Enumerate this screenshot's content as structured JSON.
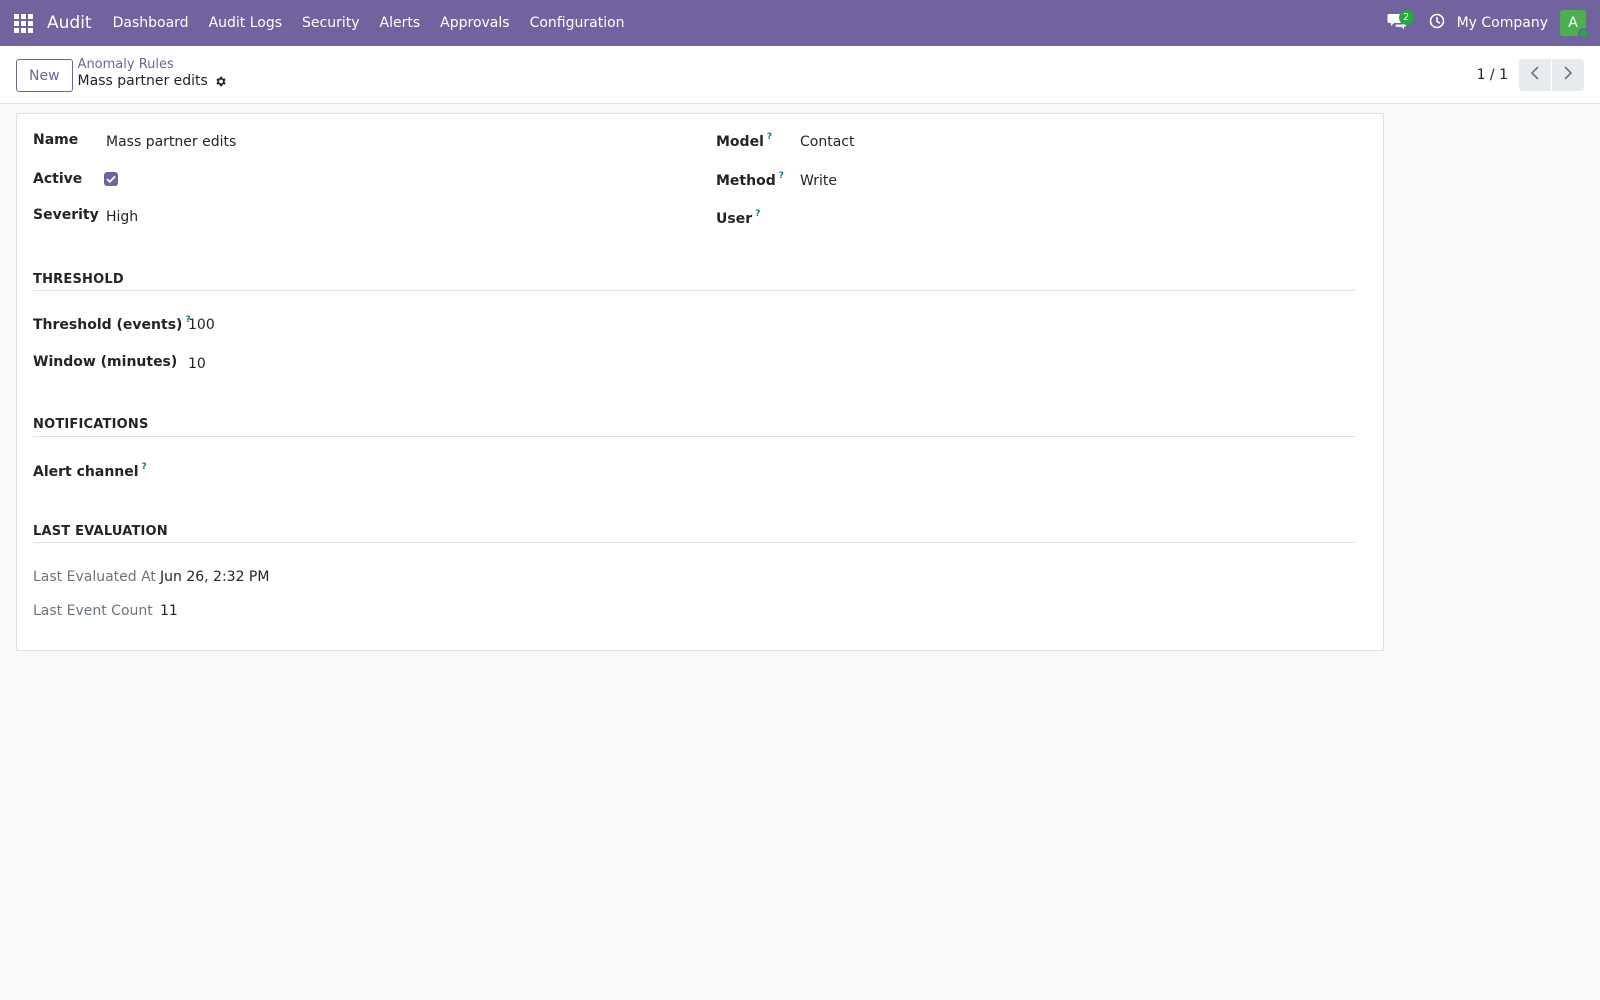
{
  "navbar": {
    "app_name": "Audit",
    "menu": [
      "Dashboard",
      "Audit Logs",
      "Security",
      "Alerts",
      "Approvals",
      "Configuration"
    ],
    "messages_count": "2",
    "company": "My Company",
    "avatar_letter": "A",
    "colors": {
      "brand": "#71639e",
      "avatar": "#4caf50",
      "badge": "#28a745"
    }
  },
  "control_panel": {
    "new_label": "New",
    "breadcrumb_parent": "Anomaly Rules",
    "breadcrumb_current": "Mass partner edits",
    "pager": "1 / 1"
  },
  "form": {
    "name_label": "Name",
    "name_value": "Mass partner edits",
    "active_label": "Active",
    "active_checked": true,
    "severity_label": "Severity",
    "severity_value": "High",
    "model_label": "Model",
    "model_value": "Contact",
    "method_label": "Method",
    "method_value": "Write",
    "user_label": "User",
    "user_value": "",
    "help_mark": "?",
    "sections": {
      "threshold": "THRESHOLD",
      "notifications": "NOTIFICATIONS",
      "last_evaluation": "LAST EVALUATION"
    },
    "threshold_label": "Threshold (events)",
    "threshold_value": "100",
    "window_label": "Window (minutes)",
    "window_value": "10",
    "alert_channel_label": "Alert channel",
    "alert_channel_value": "",
    "last_evaluated_label": "Last Evaluated At",
    "last_evaluated_value": "Jun 26, 2:32 PM",
    "last_event_count_label": "Last Event Count",
    "last_event_count_value": "11"
  }
}
